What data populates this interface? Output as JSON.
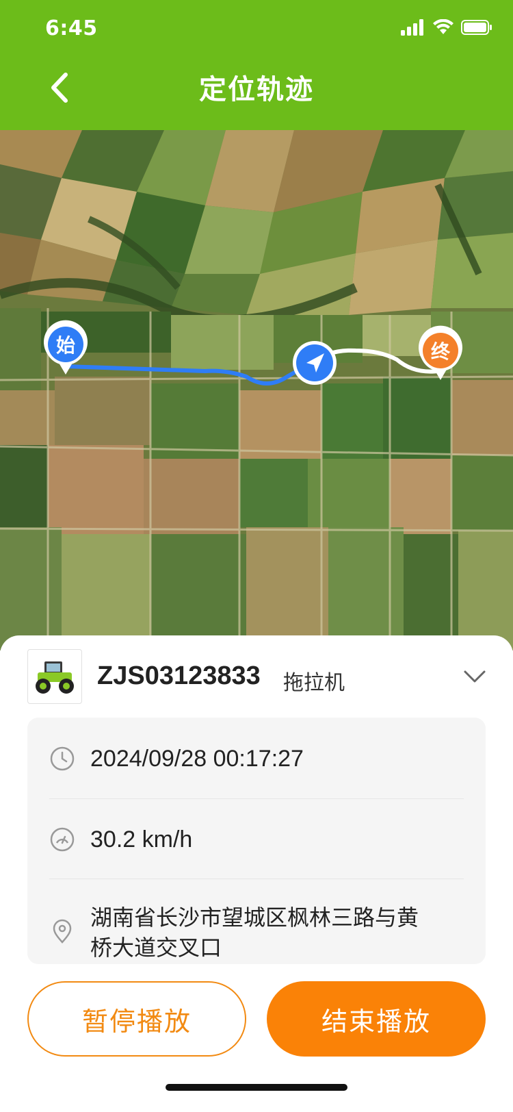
{
  "status_bar": {
    "time": "6:45"
  },
  "header": {
    "title": "定位轨迹"
  },
  "map": {
    "start_label": "始",
    "end_label": "终",
    "colors": {
      "traveled_route": "#2f7df6",
      "remaining_route": "#ffffff",
      "start_marker": "#2f7df6",
      "end_marker": "#f4802a"
    }
  },
  "vehicle": {
    "id": "ZJS03123833",
    "type": "拖拉机"
  },
  "info": {
    "time": "2024/09/28 00:17:27",
    "speed": "30.2 km/h",
    "address": "湖南省长沙市望城区枫林三路与黄桥大道交叉口"
  },
  "buttons": {
    "pause": "暂停播放",
    "stop": "结束播放"
  },
  "colors": {
    "header_bg": "#6cbc1a",
    "accent_orange": "#fa8207"
  }
}
